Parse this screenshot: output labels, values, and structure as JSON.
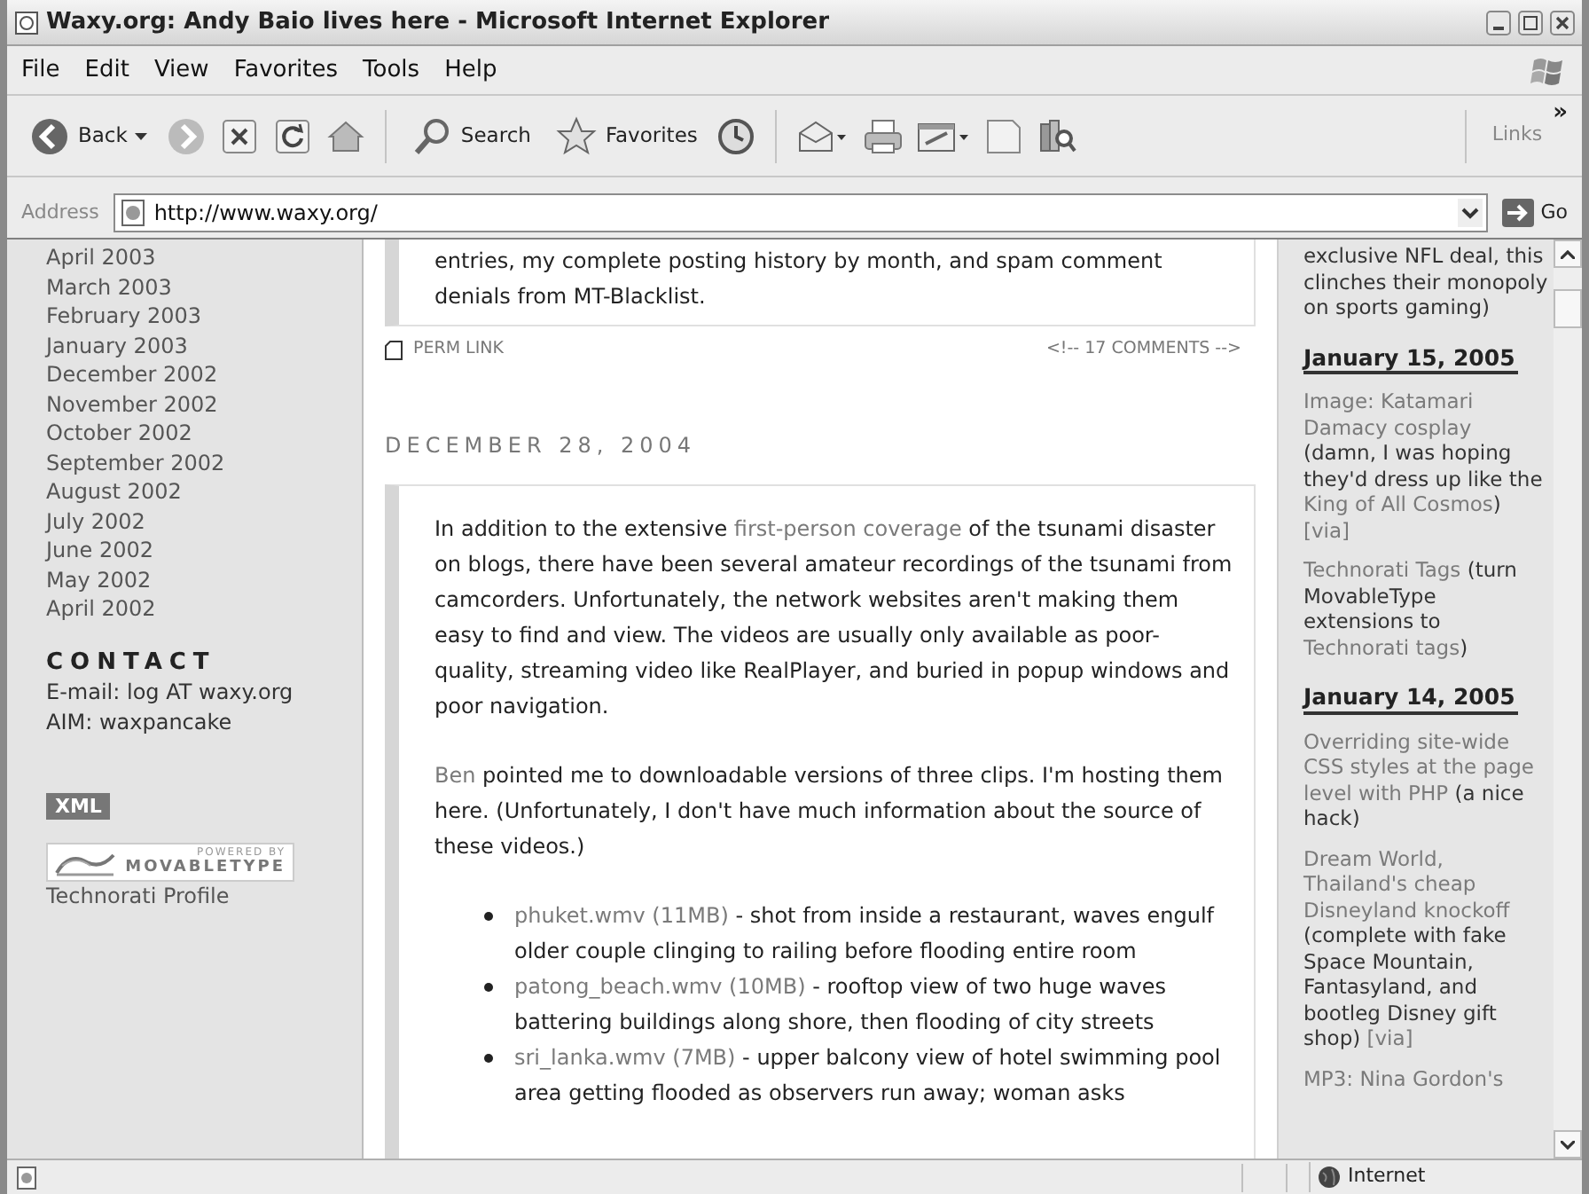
{
  "window": {
    "title": "Waxy.org: Andy Baio lives here - Microsoft Internet Explorer"
  },
  "menu": [
    "File",
    "Edit",
    "View",
    "Favorites",
    "Tools",
    "Help"
  ],
  "toolbar": [
    {
      "kind": "back",
      "label": "Back"
    },
    {
      "kind": "forward"
    },
    {
      "kind": "stop"
    },
    {
      "kind": "refresh"
    },
    {
      "kind": "home"
    },
    {
      "kind": "search",
      "label": "Search"
    },
    {
      "kind": "favorites",
      "label": "Favorites"
    },
    {
      "kind": "history"
    },
    {
      "kind": "mail"
    },
    {
      "kind": "print"
    },
    {
      "kind": "edit"
    },
    {
      "kind": "discuss"
    },
    {
      "kind": "research"
    }
  ],
  "links_bar": {
    "label": "Links",
    "chevron": "»"
  },
  "address_bar": {
    "label": "Address",
    "value": "http://www.waxy.org/",
    "go": "Go"
  },
  "left_sidebar": {
    "archive": [
      "April 2003",
      "March 2003",
      "February 2003",
      "January 2003",
      "December 2002",
      "November 2002",
      "October 2002",
      "September 2002",
      "August 2002",
      "July 2002",
      "June 2002",
      "May 2002",
      "April 2002"
    ],
    "contact_heading": "CONTACT",
    "contact": [
      "E-mail: log AT waxy.org",
      "AIM: waxpancake"
    ],
    "xml_badge": "XML",
    "powered_by": {
      "line1": "POWERED BY",
      "line2": "MOVABLETYPE"
    },
    "profile_link": "Technorati Profile"
  },
  "main": {
    "previous_post_tail": "entries, my complete posting history by month, and spam comment denials from MT-Blacklist.",
    "perm_link": "PERM LINK",
    "comments": "<!-- 17 COMMENTS -->",
    "date": "DECEMBER 28, 2004",
    "paragraphs": [
      [
        {
          "text": "In addition to the extensive ",
          "link": false
        },
        {
          "text": "first-person coverage",
          "link": true
        },
        {
          "text": " of the tsunami disaster on blogs, there have been several amateur recordings of the tsunami from camcorders. Unfortunately, the network websites aren't making them easy to find and view. The videos are usually only available as poor-quality, streaming video like RealPlayer, and buried in popup windows and poor navigation.",
          "link": false
        }
      ],
      [
        {
          "text": "Ben",
          "link": true
        },
        {
          "text": " pointed me to downloadable versions of three clips. I'm hosting them here. (Unfortunately, I don't have much information about the source of these videos.)",
          "link": false
        }
      ]
    ],
    "clips": [
      {
        "file": "phuket.wmv (11MB)",
        "description": " - shot from inside a restaurant, waves engulf older couple clinging to railing before flooding entire room"
      },
      {
        "file": "patong_beach.wmv (10MB)",
        "description": " - rooftop view of two huge waves battering buildings along shore, then flooding of city streets"
      },
      {
        "file": "sri_lanka.wmv (7MB)",
        "description": " - upper balcony view of hotel swimming pool area getting flooded as observers run away; woman asks"
      }
    ]
  },
  "right_sidebar": [
    {
      "kind": "item",
      "segments": [
        {
          "text": "exclusive NFL deal, this clinches their monopoly on sports gaming)",
          "link": false
        }
      ]
    },
    {
      "kind": "date",
      "text": "January 15, 2005"
    },
    {
      "kind": "item",
      "segments": [
        {
          "text": "Image: Katamari Damacy cosplay",
          "link": true
        },
        {
          "text": " (damn, I was hoping they'd dress up like the ",
          "link": false
        },
        {
          "text": "King of All Cosmos",
          "link": true
        },
        {
          "text": ") ",
          "link": false
        },
        {
          "text": "[via]",
          "link": true
        }
      ]
    },
    {
      "kind": "item",
      "segments": [
        {
          "text": "Technorati Tags",
          "link": true
        },
        {
          "text": " (turn MovableType extensions to ",
          "link": false
        },
        {
          "text": "Technorati tags",
          "link": true
        },
        {
          "text": ")",
          "link": false
        }
      ]
    },
    {
      "kind": "date",
      "text": "January 14, 2005"
    },
    {
      "kind": "item",
      "segments": [
        {
          "text": "Overriding site-wide CSS styles at the page level with PHP",
          "link": true
        },
        {
          "text": " (a nice hack)",
          "link": false
        }
      ]
    },
    {
      "kind": "item",
      "segments": [
        {
          "text": "Dream World, Thailand's cheap Disneyland knockoff",
          "link": true
        },
        {
          "text": " (complete with fake Space Mountain, Fantasyland, and bootleg Disney gift shop) ",
          "link": false
        },
        {
          "text": "[via]",
          "link": true
        }
      ]
    },
    {
      "kind": "item",
      "segments": [
        {
          "text": "MP3: Nina Gordon's",
          "link": true
        }
      ]
    }
  ],
  "status_bar": {
    "zone": "Internet"
  }
}
